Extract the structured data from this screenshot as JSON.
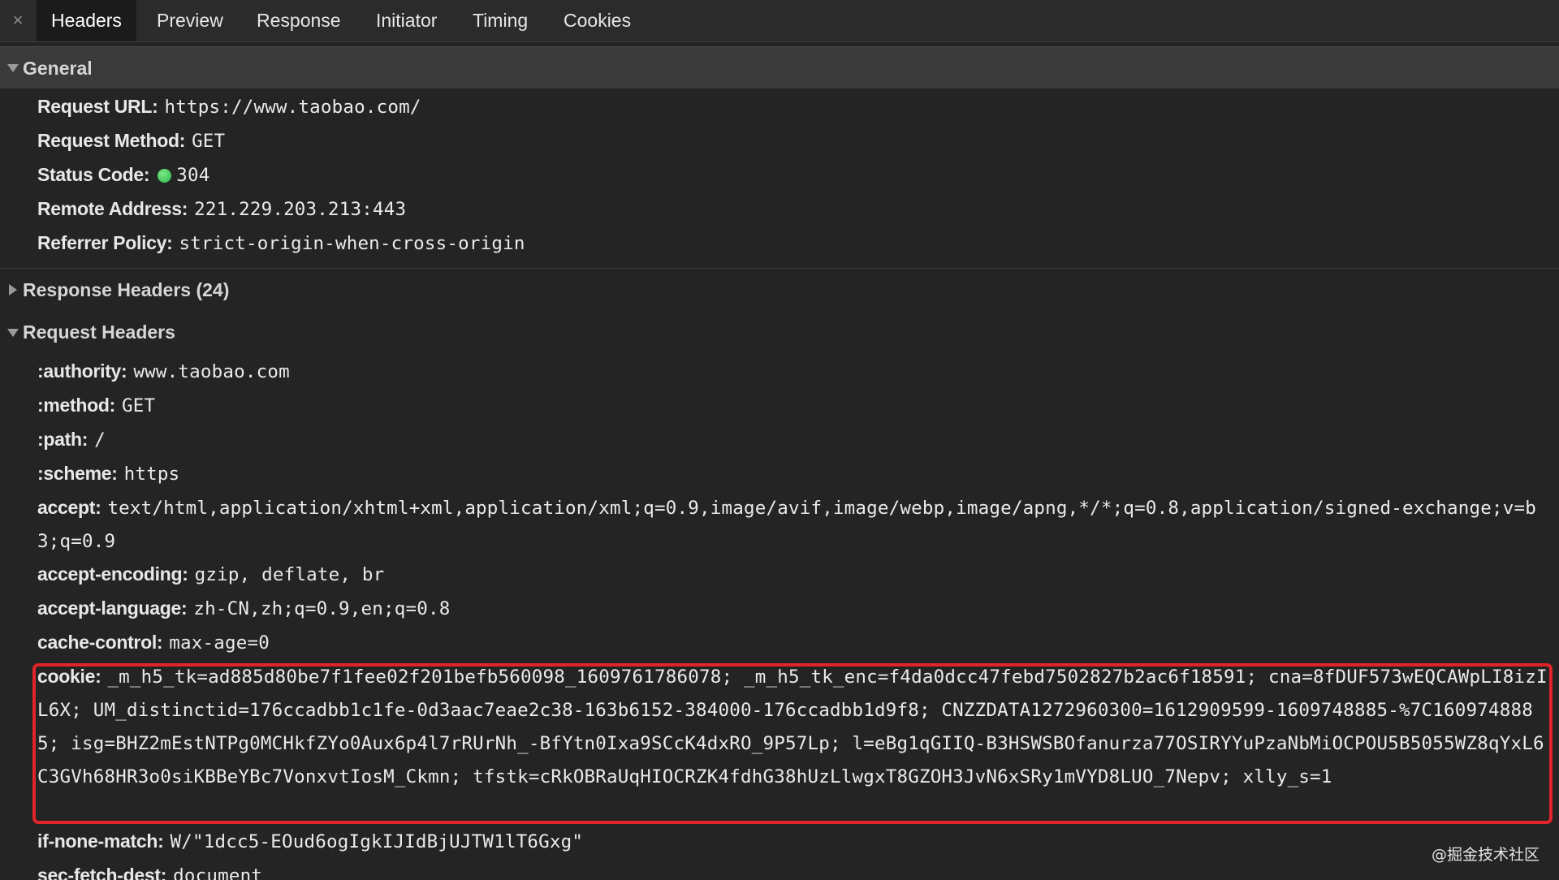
{
  "tabs": {
    "close_symbol": "×",
    "items": [
      {
        "label": "Headers",
        "active": true
      },
      {
        "label": "Preview"
      },
      {
        "label": "Response"
      },
      {
        "label": "Initiator"
      },
      {
        "label": "Timing"
      },
      {
        "label": "Cookies"
      }
    ]
  },
  "general": {
    "title": "General",
    "request_url": {
      "key": "Request URL:",
      "value": "https://www.taobao.com/"
    },
    "request_method": {
      "key": "Request Method:",
      "value": "GET"
    },
    "status_code": {
      "key": "Status Code:",
      "value": "304",
      "dot_color": "#2db84a"
    },
    "remote_address": {
      "key": "Remote Address:",
      "value": "221.229.203.213:443"
    },
    "referrer_policy": {
      "key": "Referrer Policy:",
      "value": "strict-origin-when-cross-origin"
    }
  },
  "response_headers": {
    "title": "Response Headers (24)"
  },
  "request_headers": {
    "title": "Request Headers",
    "authority": {
      "key": ":authority:",
      "value": "www.taobao.com"
    },
    "method": {
      "key": ":method:",
      "value": "GET"
    },
    "path": {
      "key": ":path:",
      "value": "/"
    },
    "scheme": {
      "key": ":scheme:",
      "value": "https"
    },
    "accept": {
      "key": "accept:",
      "value": "text/html,application/xhtml+xml,application/xml;q=0.9,image/avif,image/webp,image/apng,*/*;q=0.8,application/signed-exchange;v=b3;q=0.9"
    },
    "accept_encoding": {
      "key": "accept-encoding:",
      "value": "gzip, deflate, br"
    },
    "accept_language": {
      "key": "accept-language:",
      "value": "zh-CN,zh;q=0.9,en;q=0.8"
    },
    "cache_control": {
      "key": "cache-control:",
      "value": "max-age=0"
    },
    "cookie": {
      "key": "cookie:",
      "value": "_m_h5_tk=ad885d80be7f1fee02f201befb560098_1609761786078; _m_h5_tk_enc=f4da0dcc47febd7502827b2ac6f18591; cna=8fDUF573wEQCAWpLI8izIL6X; UM_distinctid=176ccadbb1c1fe-0d3aac7eae2c38-163b6152-384000-176ccadbb1d9f8; CNZZDATA1272960300=1612909599-1609748885-%7C1609748885; isg=BHZ2mEstNTPg0MCHkfZYo0Aux6p4l7rRUrNh_-BfYtn0Ixa9SCcK4dxRO_9P57Lp; l=eBg1qGIIQ-B3HSWSBOfanurza77OSIRYYuPzaNbMiOCPOU5B5055WZ8qYxL6C3GVh68HR3o0siKBBeYBc7VonxvtIosM_Ckmn; tfstk=cRkOBRaUqHIOCRZK4fdhG38hUzLlwgxT8GZOH3JvN6xSRy1mVYD8LUO_7Nepv; xlly_s=1"
    },
    "if_none_match": {
      "key": "if-none-match:",
      "value": "W/\"1dcc5-EOud6ogIgkIJIdBjUJTW1lT6Gxg\""
    },
    "sec_fetch_dest": {
      "key": "sec-fetch-dest:",
      "value": "document"
    }
  },
  "highlight_color": "#e0242a",
  "watermark": "@掘金技术社区"
}
